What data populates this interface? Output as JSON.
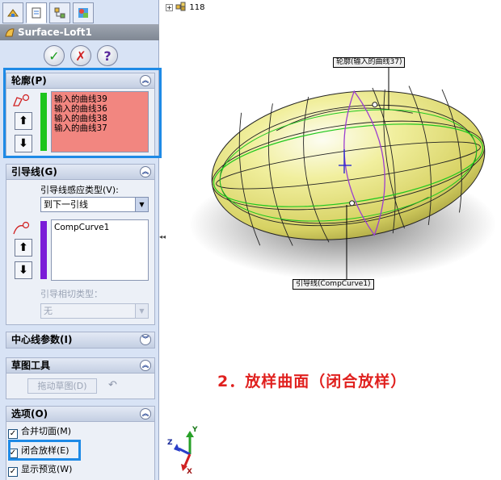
{
  "property_manager": {
    "title": "Surface-Loft1",
    "buttons": {
      "ok": "✓",
      "cancel": "✗",
      "help": "?"
    },
    "profiles": {
      "header": "轮廓(P)",
      "items": [
        "输入的曲线39",
        "输入的曲线36",
        "输入的曲线38",
        "输入的曲线37"
      ]
    },
    "guides": {
      "header": "引导线(G)",
      "influence_label": "引导线感应类型(V):",
      "influence_value": "到下一引线",
      "items": [
        "CompCurve1"
      ],
      "tangency_label": "引导相切类型：",
      "tangency_value": "无"
    },
    "centerline": {
      "header": "中心线参数(I)"
    },
    "sketch_tools": {
      "header": "草图工具",
      "drag_sketch_button": "拖动草图(D)"
    },
    "options": {
      "header": "选项(O)",
      "merge_tangent": "合并切面(M)",
      "closed_loft": "闭合放样(E)",
      "show_preview": "显示预览(W)"
    }
  },
  "viewport": {
    "tree_label": "118",
    "callout_profile": "轮廓(输入的曲线37)",
    "callout_guide": "引导线(CompCurve1)",
    "caption": "2．放样曲面（闭合放样）",
    "axes": {
      "x": "X",
      "y": "Y",
      "z": "Z"
    }
  },
  "colors": {
    "highlight": "#1e8ae6",
    "caption": "#e0201e",
    "profile_list_bg": "#f28680",
    "profile_bar": "#1dc51d",
    "guide_bar": "#7a1bd8"
  },
  "icons": [
    "loft-feature-icon",
    "feature-manager-tab-icon",
    "property-manager-tab-icon",
    "configuration-manager-tab-icon",
    "appearance-tab-icon",
    "profile-selection-icon",
    "guide-selection-icon",
    "move-up-arrow-icon",
    "move-down-arrow-icon",
    "undo-icon",
    "assembly-tree-icon",
    "chevron-up-icon",
    "chevron-down-icon"
  ]
}
